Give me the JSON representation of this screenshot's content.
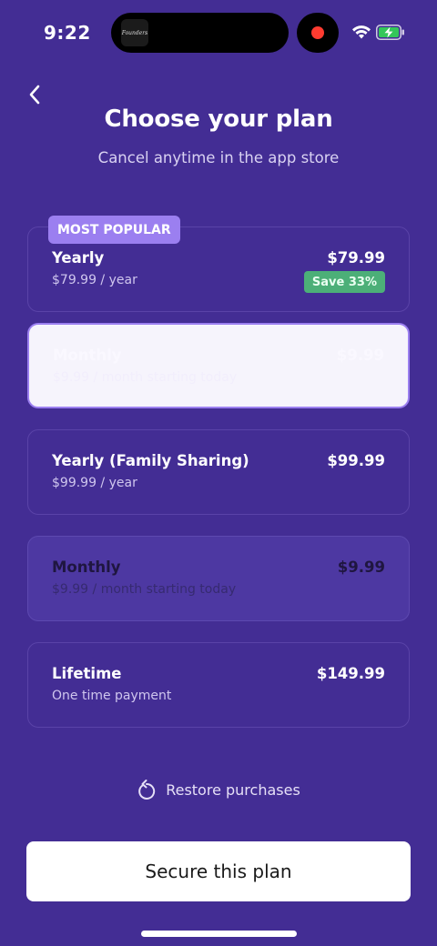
{
  "status_bar": {
    "time": "9:22",
    "island_thumb_text": "Founders",
    "wifi_icon": "wifi-icon",
    "battery_icon": "battery-charging-icon",
    "recording_color": "#ff3b30"
  },
  "header": {
    "back_icon": "chevron-left-icon",
    "title": "Choose your plan",
    "subtitle": "Cancel anytime in the app store"
  },
  "plans": [
    {
      "name": "Yearly",
      "sub": "$79.99 / year",
      "price": "$79.99",
      "badge": "MOST POPULAR",
      "save": "Save 33%",
      "state": "default"
    },
    {
      "name": "Monthly",
      "sub": "$9.99 / month starting today",
      "price": "$9.99",
      "state": "selected"
    },
    {
      "name": "Yearly (Family Sharing)",
      "sub": "$99.99 / year",
      "price": "$99.99",
      "state": "default"
    },
    {
      "name": "Monthly",
      "sub": "$9.99 / month starting today",
      "price": "$9.99",
      "state": "dim"
    },
    {
      "name": "Lifetime",
      "sub": "One time payment",
      "price": "$149.99",
      "state": "default"
    }
  ],
  "restore": {
    "label": "Restore purchases",
    "icon": "restore-icon"
  },
  "cta": {
    "label": "Secure this plan"
  },
  "colors": {
    "background": "#432d94",
    "badge_popular": "#9b7ff0",
    "badge_save": "#4caf78",
    "selected_card": "#f6f4fc"
  }
}
